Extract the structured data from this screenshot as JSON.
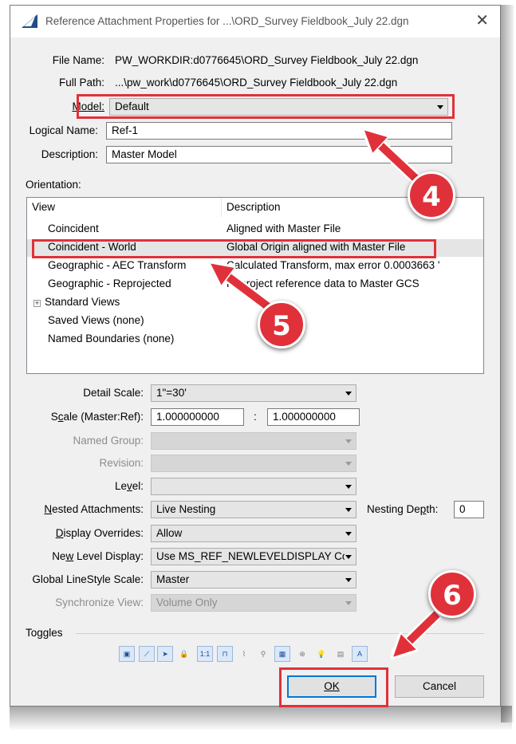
{
  "window": {
    "title": "Reference Attachment Properties for ...\\ORD_Survey Fieldbook_July 22.dgn",
    "close_glyph": "✕",
    "app_icon": "microstation-icon"
  },
  "file": {
    "file_name_label": "File Name:",
    "file_name_value": "PW_WORKDIR:d0776645\\ORD_Survey Fieldbook_July 22.dgn",
    "full_path_label": "Full Path:",
    "full_path_value": "...\\pw_work\\d0776645\\ORD_Survey Fieldbook_July 22.dgn"
  },
  "model": {
    "label": "Model:",
    "value": "Default"
  },
  "logical_name": {
    "label": "Logical Name:",
    "value": "Ref-1"
  },
  "description": {
    "label": "Description:",
    "value": "Master Model"
  },
  "orientation": {
    "label": "Orientation:",
    "columns": [
      "View",
      "Description"
    ],
    "rows": [
      {
        "view": "Coincident",
        "description": "Aligned with Master File"
      },
      {
        "view": "Coincident - World",
        "description": "Global Origin aligned with Master File",
        "selected": true
      },
      {
        "view": "Geographic - AEC Transform",
        "description": "Calculated Transform, max error 0.0003663 '"
      },
      {
        "view": "Geographic - Reprojected",
        "description": "Reproject reference data to Master GCS"
      },
      {
        "view": "Standard Views",
        "description": "",
        "expander": "+"
      },
      {
        "view": "Saved Views (none)",
        "description": ""
      },
      {
        "view": "Named Boundaries (none)",
        "description": ""
      }
    ]
  },
  "settings": {
    "detail_scale": {
      "label": "Detail Scale:",
      "value": "1\"=30'"
    },
    "scale": {
      "label": "Scale (Master:Ref):",
      "master": "1.000000000",
      "separator": ":",
      "ref": "1.000000000"
    },
    "named_group": {
      "label": "Named Group:",
      "value": ""
    },
    "revision": {
      "label": "Revision:",
      "value": ""
    },
    "level": {
      "label": "Level:",
      "value": ""
    },
    "nested_attachments": {
      "label": "Nested Attachments:",
      "value": "Live Nesting"
    },
    "nesting_depth": {
      "label": "Nesting Depth:",
      "value": "0"
    },
    "display_overrides": {
      "label": "Display Overrides:",
      "value": "Allow"
    },
    "new_level_display": {
      "label": "New Level Display:",
      "value": "Use MS_REF_NEWLEVELDISPLAY Cor"
    },
    "global_linestyle_scale": {
      "label": "Global LineStyle Scale:",
      "value": "Master"
    },
    "synchronize_view": {
      "label": "Synchronize View:",
      "value": "Volume Only"
    }
  },
  "toggles": {
    "label": "Toggles",
    "items": [
      {
        "name": "display-toggle-icon",
        "glyph": "▣",
        "on": true
      },
      {
        "name": "snap-toggle-icon",
        "glyph": "⟋",
        "on": true
      },
      {
        "name": "locate-toggle-icon",
        "glyph": "➤",
        "on": true
      },
      {
        "name": "lock-toggle-icon",
        "glyph": "🔒",
        "on": false
      },
      {
        "name": "true-scale-toggle-icon",
        "glyph": "1:1",
        "on": true
      },
      {
        "name": "scale-linestyles-toggle-icon",
        "glyph": "⊓",
        "on": true
      },
      {
        "name": "use-lights-toggle-icon",
        "glyph": "⌇",
        "on": false
      },
      {
        "name": "treat-as-element-toggle-icon",
        "glyph": "⚲",
        "on": false
      },
      {
        "name": "display-raster-toggle-icon",
        "glyph": "▦",
        "on": true
      },
      {
        "name": "clip-toggle-icon",
        "glyph": "⊕",
        "on": false
      },
      {
        "name": "light-bulb-toggle-icon",
        "glyph": "💡",
        "on": false
      },
      {
        "name": "nested-toggle-icon",
        "glyph": "▤",
        "on": false
      },
      {
        "name": "text-toggle-icon",
        "glyph": "A",
        "on": true
      }
    ]
  },
  "buttons": {
    "ok": "OK",
    "cancel": "Cancel"
  },
  "annotations": {
    "step4": "4",
    "step5": "5",
    "step6": "6",
    "color": "#e0313a"
  }
}
